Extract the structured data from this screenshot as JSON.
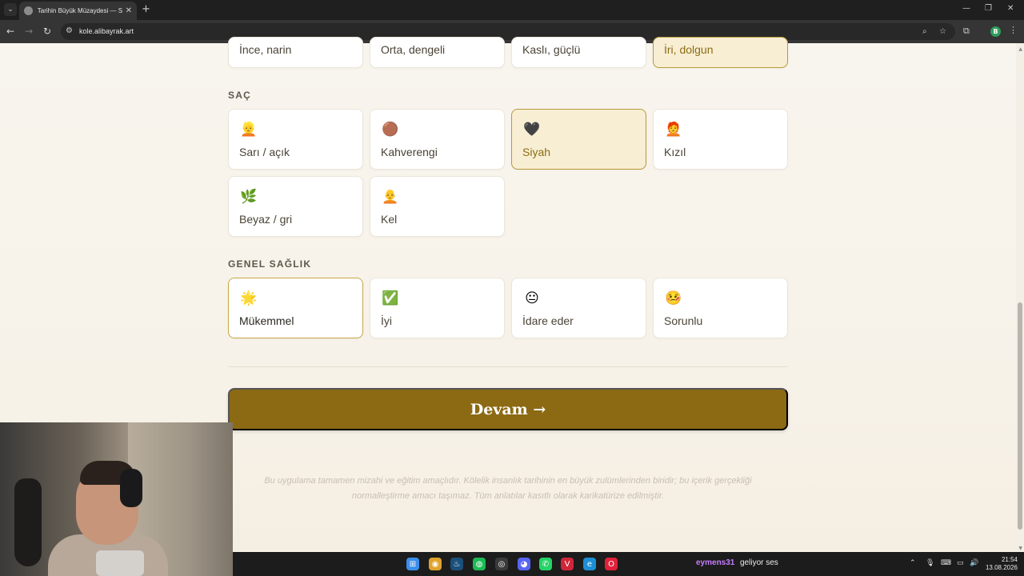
{
  "browser": {
    "tab_title": "Tarihin Büyük Müzaydesi — Se...",
    "url": "kole.alibayrak.art",
    "profile_initial": "B",
    "icons": {
      "tab_list": "chevron-down-icon",
      "tab_close": "close-icon",
      "new_tab": "plus-icon",
      "back": "arrow-left-icon",
      "forward": "arrow-right-icon",
      "reload": "reload-icon",
      "site_info": "tune-icon",
      "zoom": "zoom-icon",
      "bookmark": "star-icon",
      "extensions": "puzzle-icon",
      "menu": "kebab-menu-icon"
    },
    "glyphs": {
      "tab_list": "⌄",
      "tab_close": "✕",
      "new_tab": "+",
      "back": "←",
      "forward": "→",
      "reload": "↻",
      "site_info": "⚙",
      "zoom": "⌕",
      "bookmark": "☆",
      "extensions": "⧉",
      "menu": "⋮",
      "minimize": "—",
      "maximize": "❐",
      "close_window": "✕"
    }
  },
  "page": {
    "body_type_row": [
      {
        "label": "İnce, narin",
        "selected": false
      },
      {
        "label": "Orta, dengeli",
        "selected": false
      },
      {
        "label": "Kaslı, güçlü",
        "selected": false
      },
      {
        "label": "İri, dolgun",
        "selected": true
      }
    ],
    "hair": {
      "title": "SAÇ",
      "options": [
        {
          "emoji": "👱",
          "label": "Sarı / açık",
          "selected": false
        },
        {
          "emoji": "🟤",
          "label": "Kahverengi",
          "selected": false
        },
        {
          "emoji": "🖤",
          "label": "Siyah",
          "selected": true
        },
        {
          "emoji": "🧑‍🦰",
          "label": "Kızıl",
          "selected": false
        },
        {
          "emoji": "🌿",
          "label": "Beyaz / gri",
          "selected": false
        },
        {
          "emoji": "🧑‍🦲",
          "label": "Kel",
          "selected": false
        }
      ]
    },
    "health": {
      "title": "GENEL SAĞLIK",
      "options": [
        {
          "emoji": "🌟",
          "label": "Mükemmel",
          "selected": true
        },
        {
          "emoji": "✅",
          "label": "İyi",
          "selected": false
        },
        {
          "emoji": "😐",
          "label": "İdare eder",
          "selected": false
        },
        {
          "emoji": "🤒",
          "label": "Sorunlu",
          "selected": false
        }
      ]
    },
    "continue_label": "Devam →",
    "disclaimer_line1": "Bu uygulama tamamen mizahi ve eğitim amaçlıdır. Kölelik insanlık tarihinin en büyük zulümlerinden biridir; bu içerik gerçekliği",
    "disclaimer_line2": "normalleştirme amacı taşımaz. Tüm anlatılar kasıtlı olarak karikatürize edilmiştir."
  },
  "taskbar": {
    "apps": [
      {
        "name": "windows-start-icon",
        "glyph": "⊞",
        "color": "#3b8eea"
      },
      {
        "name": "chrome-icon",
        "glyph": "◉",
        "color": "#e0a22b"
      },
      {
        "name": "steam-icon",
        "glyph": "♨",
        "color": "#1b4f7a"
      },
      {
        "name": "spotify-icon",
        "glyph": "◍",
        "color": "#1db954"
      },
      {
        "name": "obs-icon",
        "glyph": "◎",
        "color": "#3a3a3a"
      },
      {
        "name": "discord-icon",
        "glyph": "◕",
        "color": "#5865f2"
      },
      {
        "name": "whatsapp-icon",
        "glyph": "✆",
        "color": "#25d366"
      },
      {
        "name": "valorant-icon",
        "glyph": "V",
        "color": "#d1263a"
      },
      {
        "name": "edge-icon",
        "glyph": "e",
        "color": "#1d8fd6"
      },
      {
        "name": "opera-icon",
        "glyph": "O",
        "color": "#e0213a"
      }
    ],
    "stream_user": "eymens31",
    "stream_message": "geliyor ses",
    "time": "21:54",
    "date": "13.08.2026",
    "tray": [
      {
        "name": "chevron-up-icon",
        "glyph": "⌃"
      },
      {
        "name": "microphone-icon",
        "glyph": "🎙"
      },
      {
        "name": "keyboard-icon",
        "glyph": "⌨"
      },
      {
        "name": "monitor-icon",
        "glyph": "▭"
      },
      {
        "name": "speaker-icon",
        "glyph": "🔊"
      }
    ]
  },
  "colors": {
    "accent": "#8c6a13",
    "selected_bg": "#f8eed3",
    "selected_border": "#b89a3a",
    "page_bg": "#f7f3ea"
  }
}
